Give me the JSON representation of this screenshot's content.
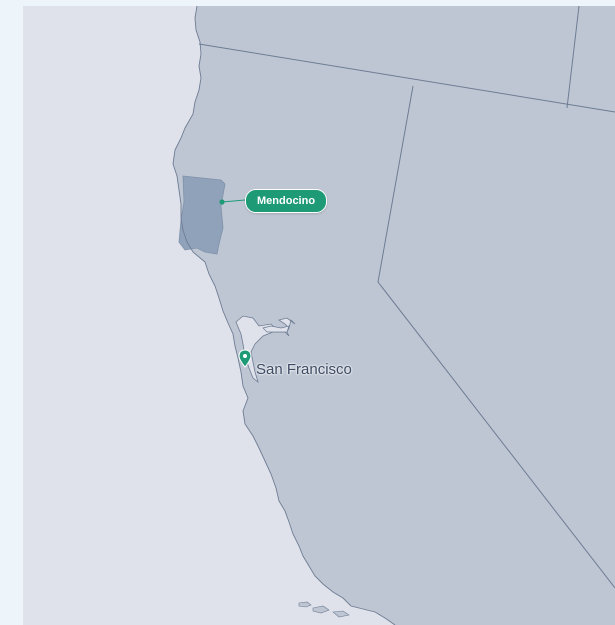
{
  "map": {
    "colors": {
      "ocean": "#dfe2ea",
      "land": "#bec6d3",
      "border": "#6e7c93",
      "highlight_region": "#8fa2ba",
      "accent": "#1f9a76",
      "city_text": "#3c4a63",
      "page_background": "#eef5fa"
    },
    "highlighted_region": {
      "label": "Mendocino",
      "icon": "dot-marker-icon"
    },
    "marker": {
      "label": "San Francisco",
      "icon": "map-pin-icon"
    }
  }
}
